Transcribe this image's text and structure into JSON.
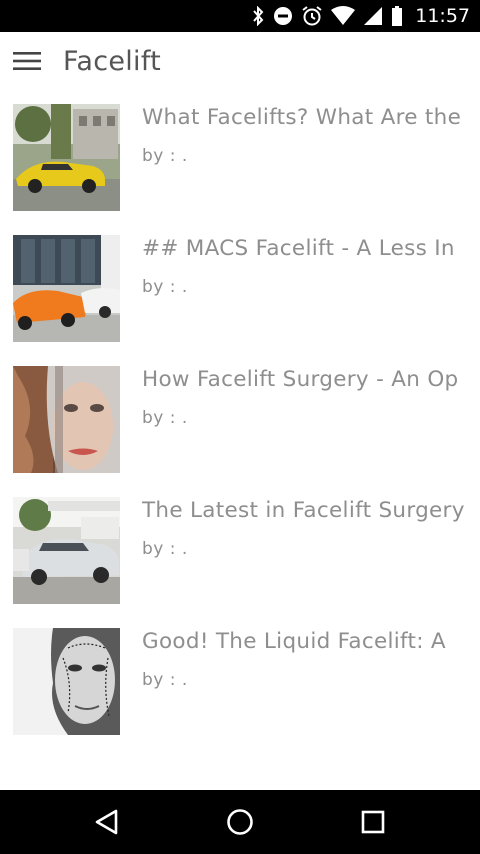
{
  "status_bar": {
    "time": "11:57",
    "icons": [
      "bluetooth-icon",
      "do-not-disturb-icon",
      "alarm-icon",
      "wifi-icon",
      "cell-signal-icon",
      "battery-icon"
    ]
  },
  "toolbar": {
    "menu_icon": "hamburger-menu-icon",
    "title": "Facelift"
  },
  "articles": [
    {
      "title": "What Facelifts? What Are the",
      "byline": "by : .",
      "thumb": "yellow-sports-car"
    },
    {
      "title": "## MACS Facelift - A Less In",
      "byline": "by : .",
      "thumb": "orange-convertible"
    },
    {
      "title": "How Facelift Surgery - An Op",
      "byline": "by : .",
      "thumb": "woman-face"
    },
    {
      "title": "The Latest in Facelift Surgery",
      "byline": "by : .",
      "thumb": "silver-sedan"
    },
    {
      "title": "Good! The Liquid Facelift: A",
      "byline": "by : .",
      "thumb": "face-surgery-markings"
    }
  ],
  "nav_bar": {
    "buttons": [
      "back-icon",
      "home-icon",
      "recents-icon"
    ]
  }
}
